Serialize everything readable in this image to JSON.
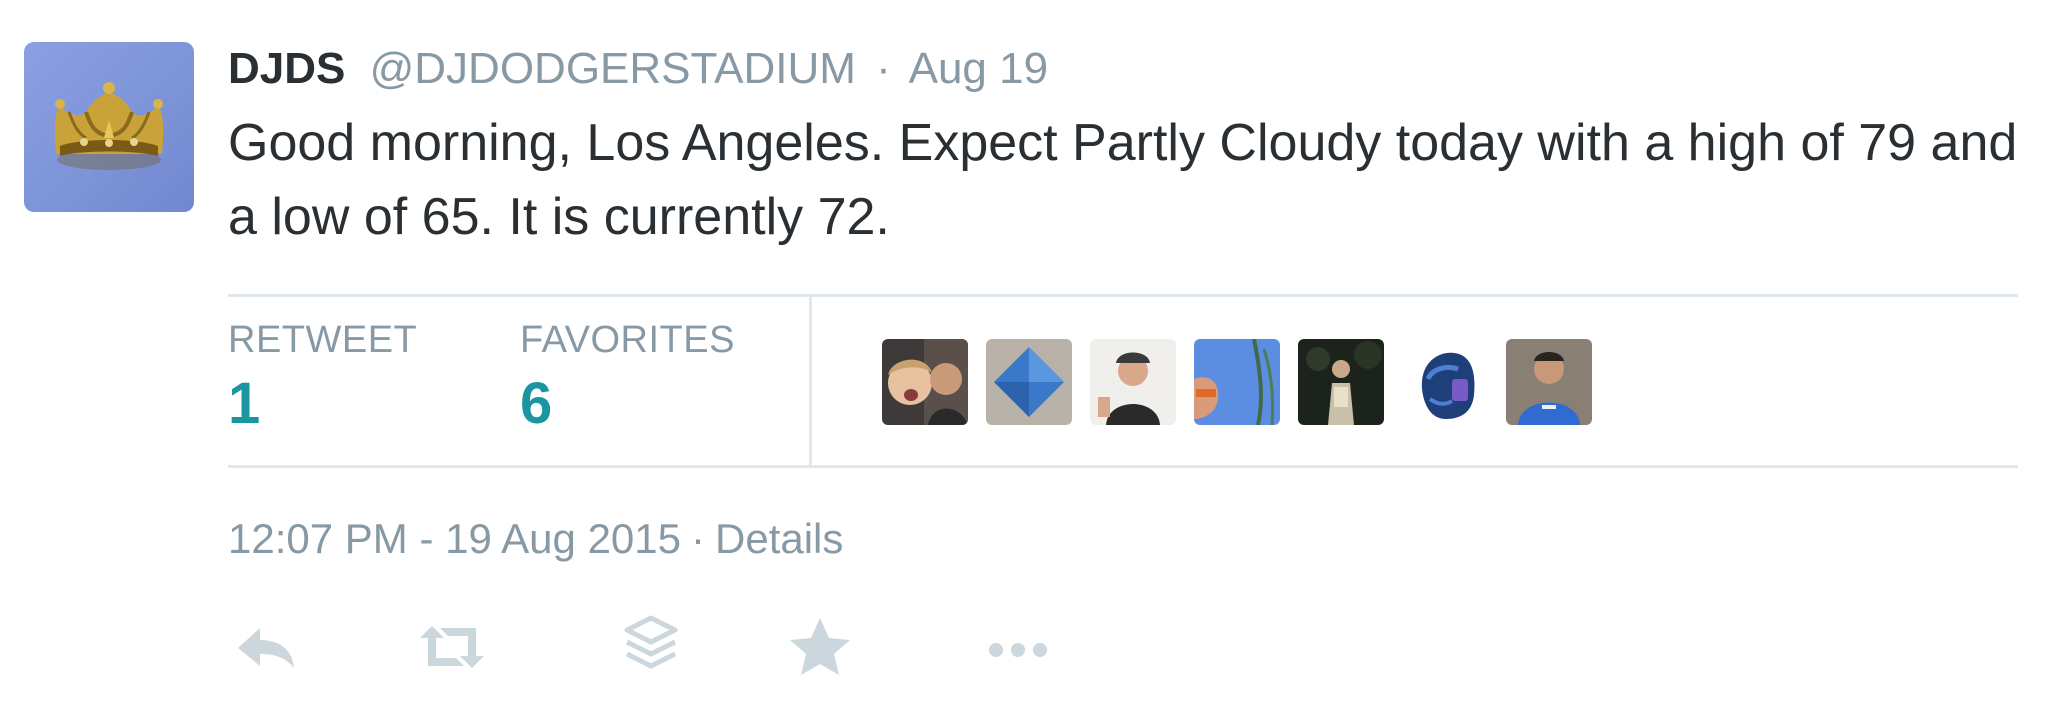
{
  "tweet": {
    "display_name": "DJDS",
    "handle": "@DJDODGERSTADIUM",
    "separator": "·",
    "date": "Aug 19",
    "text": "Good morning, Los Angeles. Expect Partly Cloudy today with a high of 79 and a low of 65. It is currently 72."
  },
  "stats": {
    "retweet_label": "RETWEET",
    "retweet_count": "1",
    "favorites_label": "FAVORITES",
    "favorites_count": "6"
  },
  "timestamp": {
    "time_date": "12:07 PM - 19 Aug 2015",
    "separator": "·",
    "details_link": "Details"
  },
  "icons": {
    "avatar": "crown-icon",
    "actions": [
      "reply-icon",
      "retweet-icon",
      "stack-icon",
      "favorite-star-icon",
      "more-icon"
    ]
  },
  "colors": {
    "text": "#292f33",
    "muted": "#8899a6",
    "stat_value": "#1b95a0",
    "divider": "#e1e8ed",
    "action_icon": "#ccd6dd",
    "avatar_bg": "#8aa0e2"
  }
}
